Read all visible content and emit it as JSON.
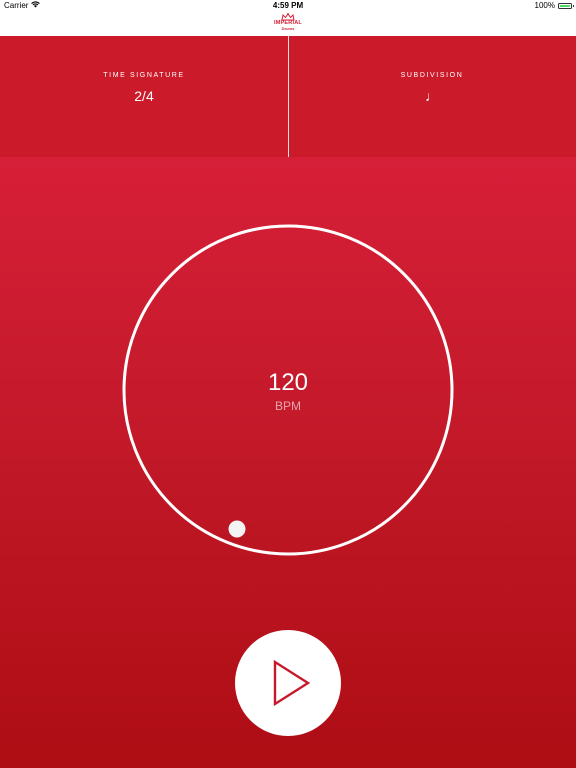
{
  "status_bar": {
    "carrier": "Carrier",
    "time": "4:59 PM",
    "battery": "100%",
    "battery_color": "#4cd964",
    "wifi_icon": "wifi-icon"
  },
  "nav": {
    "logo_word": "IMPERIAL",
    "logo_sub": "Drums",
    "logo_icon": "crown-icon"
  },
  "settings": {
    "time_signature": {
      "label": "TIME SIGNATURE",
      "value": "2/4"
    },
    "subdivision": {
      "label": "SUBDIVISION",
      "value": "♩",
      "icon": "quarter-note-icon"
    }
  },
  "metronome": {
    "bpm": "120",
    "unit": "BPM",
    "play_icon": "play-icon"
  },
  "colors": {
    "accent": "#cb1a2a",
    "gradient_top": "#d71f38",
    "gradient_bottom": "#ae0d14",
    "white": "#ffffff"
  }
}
